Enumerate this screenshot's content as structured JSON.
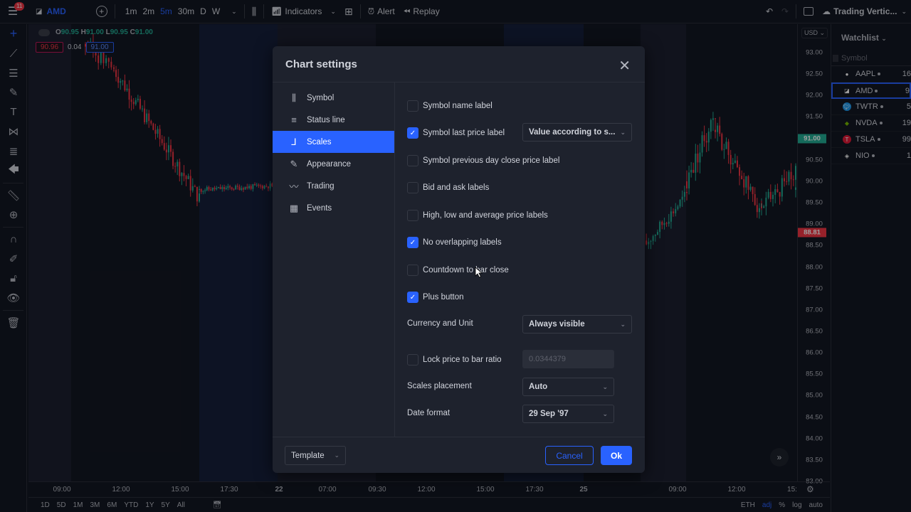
{
  "topbar": {
    "notification_count": "11",
    "symbol": "AMD",
    "intervals": [
      "1m",
      "2m",
      "5m",
      "30m",
      "D",
      "W"
    ],
    "active_interval": "5m",
    "indicators_label": "Indicators",
    "alert_label": "Alert",
    "replay_label": "Replay",
    "layout_name": "Trading Vertic..."
  },
  "legend": {
    "open": "90.95",
    "high": "91.00",
    "low": "90.95",
    "close": "91.00",
    "bid": "90.96",
    "spread": "0.04",
    "ask": "91.00"
  },
  "price_axis": {
    "currency": "USD",
    "labels": [
      "93.00",
      "92.50",
      "92.00",
      "91.50",
      "91.00",
      "90.50",
      "90.00",
      "89.50",
      "89.00",
      "88.50",
      "88.00",
      "87.50",
      "87.00",
      "86.50",
      "86.00",
      "85.50",
      "85.00",
      "84.50",
      "84.00",
      "83.50",
      "83.00"
    ],
    "last_price_tag": "91.00",
    "current_price_tag": "88.81",
    "colors": {
      "up": "#22ab94",
      "down": "#f23645"
    }
  },
  "time_axis": {
    "labels": [
      "09:00",
      "12:00",
      "15:00",
      "17:30",
      "22",
      "07:00",
      "09:30",
      "12:00",
      "15:00",
      "17:30",
      "25",
      "09:00",
      "12:00",
      "15:"
    ]
  },
  "bottombar": {
    "ranges": [
      "1D",
      "5D",
      "1M",
      "3M",
      "6M",
      "YTD",
      "1Y",
      "5Y",
      "All"
    ],
    "session": "ETH",
    "adj": "adj",
    "percent": "%",
    "log": "log",
    "auto": "auto"
  },
  "watchlist": {
    "title": "Watchlist",
    "column": "Symbol",
    "items": [
      {
        "symbol": "AAPL",
        "value": "16",
        "logo_color": "#ffffff"
      },
      {
        "symbol": "AMD",
        "value": "9",
        "logo_color": "#ffffff",
        "active": true
      },
      {
        "symbol": "TWTR",
        "value": "5",
        "logo_color": "#1d9bf0"
      },
      {
        "symbol": "NVDA",
        "value": "19",
        "logo_color": "#76b900"
      },
      {
        "symbol": "TSLA",
        "value": "99",
        "logo_color": "#e31937"
      },
      {
        "symbol": "NIO",
        "value": "1",
        "logo_color": "#ffffff"
      }
    ]
  },
  "dialog": {
    "title": "Chart settings",
    "nav": [
      {
        "label": "Symbol",
        "icon": "candles-icon"
      },
      {
        "label": "Status line",
        "icon": "status-line-icon"
      },
      {
        "label": "Scales",
        "icon": "scales-icon",
        "active": true
      },
      {
        "label": "Appearance",
        "icon": "pencil-icon"
      },
      {
        "label": "Trading",
        "icon": "trading-icon"
      },
      {
        "label": "Events",
        "icon": "calendar-icon"
      }
    ],
    "options": {
      "symbol_name_label": {
        "label": "Symbol name label",
        "checked": false
      },
      "symbol_last_price_label": {
        "label": "Symbol last price label",
        "checked": true,
        "select": "Value according to s..."
      },
      "prev_day_close": {
        "label": "Symbol previous day close price label",
        "checked": false
      },
      "bid_ask": {
        "label": "Bid and ask labels",
        "checked": false
      },
      "high_low_avg": {
        "label": "High, low and average price labels",
        "checked": false
      },
      "no_overlap": {
        "label": "No overlapping labels",
        "checked": true
      },
      "countdown": {
        "label": "Countdown to bar close",
        "checked": false
      },
      "plus_button": {
        "label": "Plus button",
        "checked": true
      },
      "currency_unit": {
        "label": "Currency and Unit",
        "select": "Always visible"
      },
      "lock_price": {
        "label": "Lock price to bar ratio",
        "checked": false,
        "value": "0.0344379"
      },
      "scales_placement": {
        "label": "Scales placement",
        "select": "Auto"
      },
      "date_format": {
        "label": "Date format",
        "select": "29 Sep '97"
      }
    },
    "template_label": "Template",
    "cancel_label": "Cancel",
    "ok_label": "Ok"
  }
}
